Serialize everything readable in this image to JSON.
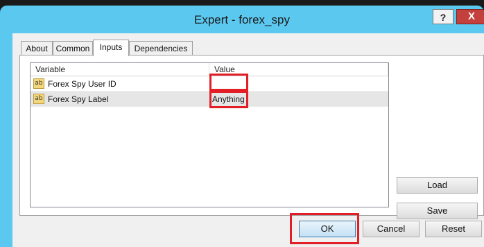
{
  "window": {
    "title": "Expert - forex_spy",
    "help_label": "?",
    "close_label": "X"
  },
  "tabs": [
    {
      "label": "About",
      "active": false
    },
    {
      "label": "Common",
      "active": false
    },
    {
      "label": "Inputs",
      "active": true
    },
    {
      "label": "Dependencies",
      "active": false
    }
  ],
  "grid": {
    "columns": [
      "Variable",
      "Value"
    ],
    "rows": [
      {
        "icon": "ab",
        "variable": "Forex Spy User ID",
        "value": ""
      },
      {
        "icon": "ab",
        "variable": "Forex Spy Label",
        "value": "Anything"
      }
    ]
  },
  "side_buttons": {
    "load": "Load",
    "save": "Save"
  },
  "footer_buttons": {
    "ok": "OK",
    "cancel": "Cancel",
    "reset": "Reset"
  },
  "colors": {
    "highlight": "#e21f26",
    "title_bar": "#5bc8f0",
    "close": "#c4403c"
  }
}
